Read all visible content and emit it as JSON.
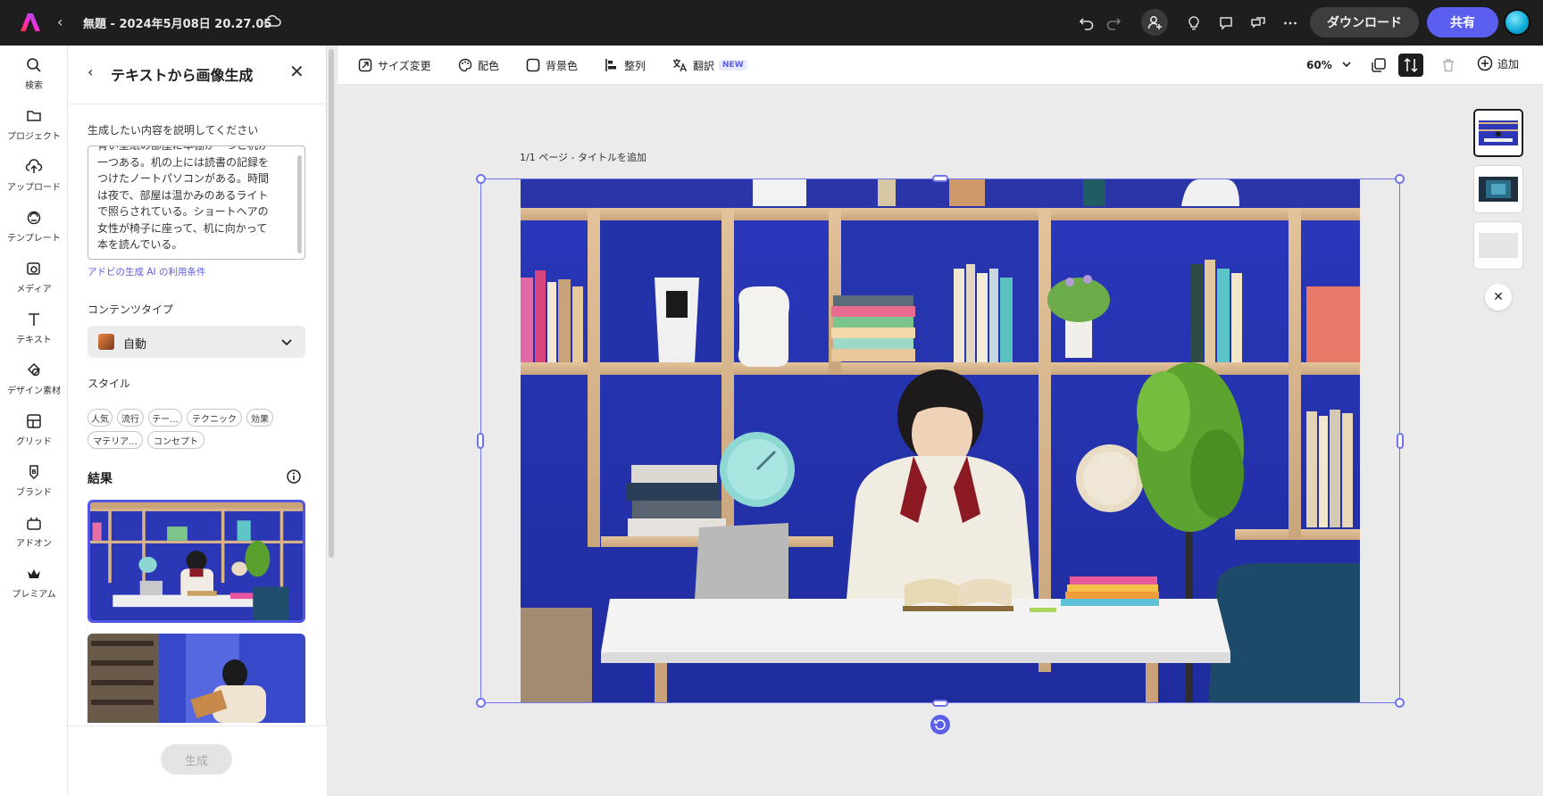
{
  "topbar": {
    "doc_title": "無題 - 2024年5月08日 20.27.05",
    "download_label": "ダウンロード",
    "share_label": "共有"
  },
  "rail": {
    "items": [
      {
        "label": "検索",
        "icon": "search-icon"
      },
      {
        "label": "プロジェクト",
        "icon": "folder-icon"
      },
      {
        "label": "アップロード",
        "icon": "upload-icon"
      },
      {
        "label": "テンプレート",
        "icon": "template-icon"
      },
      {
        "label": "メディア",
        "icon": "media-icon"
      },
      {
        "label": "テキスト",
        "icon": "text-icon"
      },
      {
        "label": "デザイン素材",
        "icon": "shapes-icon"
      },
      {
        "label": "グリッド",
        "icon": "grid-icon"
      },
      {
        "label": "ブランド",
        "icon": "brand-icon"
      },
      {
        "label": "アドオン",
        "icon": "addon-icon"
      },
      {
        "label": "プレミアム",
        "icon": "crown-icon"
      }
    ]
  },
  "panel": {
    "title": "テキストから画像生成",
    "prompt_label": "生成したい内容を説明してください",
    "prompt_lines": [
      "青い壁紙の部屋に本棚が一つと机が",
      "一つある。机の上には読書の記録を",
      "つけたノートパソコンがある。時間",
      "は夜で、部屋は温かみのあるライト",
      "で照らされている。ショートヘアの",
      "女性が椅子に座って、机に向かって",
      "本を読んでいる。"
    ],
    "terms_link": "アドビの生成 AI の利用条件",
    "content_type_label": "コンテンツタイプ",
    "content_type_value": "自動",
    "style_label": "スタイル",
    "style_chips": [
      "人気",
      "流行",
      "テー...",
      "テクニック",
      "効果",
      "マテリア...",
      "コンセプト"
    ],
    "results_label": "結果",
    "generate_label": "生成"
  },
  "canvas_toolbar": {
    "resize": "サイズ変更",
    "color": "配色",
    "background": "背景色",
    "align": "整列",
    "translate": "翻訳",
    "new_badge": "NEW",
    "zoom": "60%",
    "add": "追加"
  },
  "canvas": {
    "page_label": "1/1 ページ - タイトルを追加"
  },
  "colors": {
    "accent": "#5b5ff0",
    "selection": "#6f74e8",
    "wall_blue": "#2533b0",
    "topbar_bg": "#1e1e1e"
  }
}
